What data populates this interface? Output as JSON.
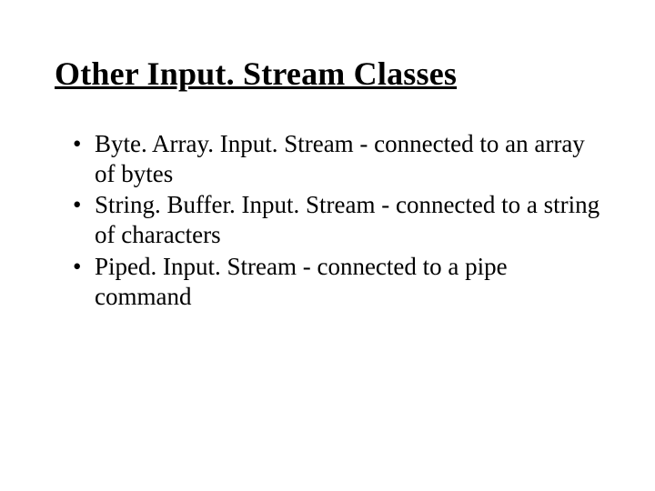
{
  "slide": {
    "title": "Other Input. Stream Classes",
    "bullets": [
      "Byte. Array. Input. Stream - connected to an array of bytes",
      "String. Buffer. Input. Stream - connected to a string of characters",
      "Piped. Input. Stream - connected to a pipe command"
    ]
  }
}
